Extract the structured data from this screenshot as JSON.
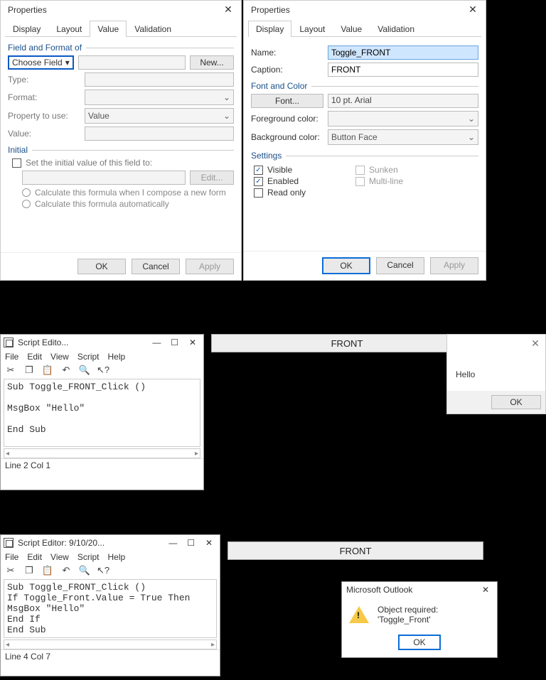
{
  "dlg_left": {
    "title": "Properties",
    "tabs": [
      "Display",
      "Layout",
      "Value",
      "Validation"
    ],
    "active_tab": "Value",
    "group_field": "Field and Format of",
    "choose_field": "Choose Field",
    "new_btn": "New...",
    "row_type": "Type:",
    "row_format": "Format:",
    "row_prop": "Property to use:",
    "prop_value": "Value",
    "row_value": "Value:",
    "group_initial": "Initial",
    "chk_initval": "Set the initial value of this field to:",
    "edit_btn": "Edit...",
    "radio_compose": "Calculate this formula when I compose a new form",
    "radio_auto": "Calculate this formula automatically",
    "ok": "OK",
    "cancel": "Cancel",
    "apply": "Apply"
  },
  "dlg_right": {
    "title": "Properties",
    "tabs": [
      "Display",
      "Layout",
      "Value",
      "Validation"
    ],
    "active_tab": "Display",
    "row_name": "Name:",
    "name_val": "Toggle_FRONT",
    "row_caption": "Caption:",
    "caption_val": "FRONT",
    "group_font": "Font and Color",
    "font_btn": "Font...",
    "font_val": "10 pt. Arial",
    "row_fg": "Foreground color:",
    "row_bg": "Background color:",
    "bg_val": "Button Face",
    "group_settings": "Settings",
    "chk_visible": "Visible",
    "chk_enabled": "Enabled",
    "chk_readonly": "Read only",
    "chk_sunken": "Sunken",
    "chk_multiline": "Multi-line",
    "ok": "OK",
    "cancel": "Cancel",
    "apply": "Apply"
  },
  "editor1": {
    "title": "Script Edito...",
    "menus": [
      "File",
      "Edit",
      "View",
      "Script",
      "Help"
    ],
    "code": "Sub Toggle_FRONT_Click ()\n\nMsgBox \"Hello\"\n\nEnd Sub",
    "status": "Line 2 Col 1"
  },
  "front_label": "FRONT",
  "hello_dlg": {
    "text": "Hello",
    "ok": "OK"
  },
  "editor2": {
    "title": "Script Editor: 9/10/20...",
    "menus": [
      "File",
      "Edit",
      "View",
      "Script",
      "Help"
    ],
    "code": "Sub Toggle_FRONT_Click ()\nIf Toggle_Front.Value = True Then\nMsgBox \"Hello\"\nEnd If\nEnd Sub",
    "status": "Line 4 Col 7"
  },
  "err_dlg": {
    "title": "Microsoft Outlook",
    "msg": "Object required: 'Toggle_Front'",
    "ok": "OK"
  }
}
